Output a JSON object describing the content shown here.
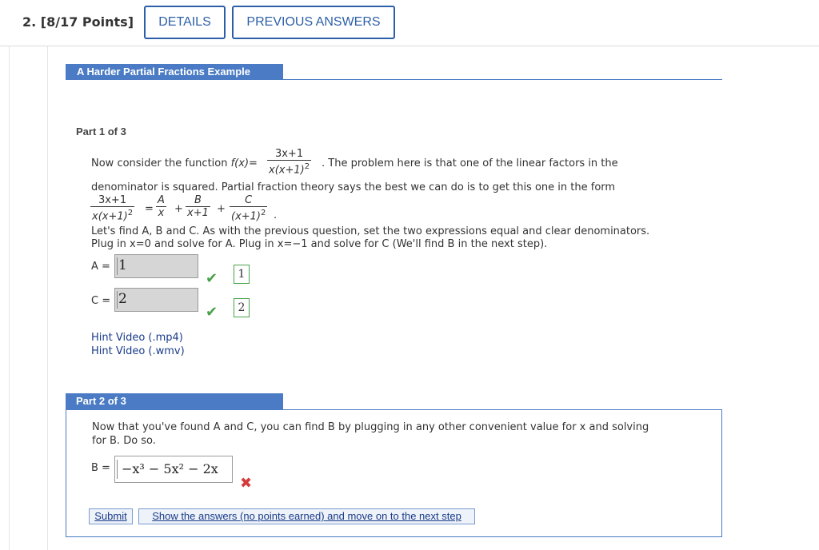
{
  "header": {
    "question_number": "2.",
    "points": "[8/17 Points]",
    "details_label": "DETAILS",
    "previous_answers_label": "PREVIOUS ANSWERS"
  },
  "section": {
    "title": "A Harder Partial Fractions Example"
  },
  "part1": {
    "label": "Part 1 of 3",
    "intro_prefix": "Now consider the function ",
    "fx": "f(x)=",
    "f_num": "3x+1",
    "f_den": "x(x+1)",
    "intro_suffix": ". The problem here is that one of the linear factors in the",
    "line2": "denominator is squared. Partial fraction theory says the best we can do is to get this one in the form",
    "eq_lhs_num": "3x+1",
    "eq_lhs_den": "x(x+1)",
    "eq_a_num": "A",
    "eq_a_den": "x",
    "eq_b_num": "B",
    "eq_b_den": "x+1",
    "eq_c_num": "C",
    "eq_c_den": "(x+1)",
    "line3": "Let's find A, B and C. As with the previous question, set the two expressions equal and clear denominators.",
    "line4": "Plug in x=0 and solve for A. Plug in x=−1 and solve for C (We'll find B in the next step).",
    "a_label": "A =",
    "a_value": "1",
    "a_key": "1",
    "c_label": "C =",
    "c_value": "2",
    "c_key": "2",
    "hint_mp4": "Hint Video (.mp4)",
    "hint_wmv": "Hint Video (.wmv)"
  },
  "part2": {
    "label": "Part 2 of 3",
    "line1": "Now that you've found A and C, you can find B by plugging in any other convenient value for x and solving",
    "line2": "for B. Do so.",
    "b_label": "B =",
    "b_value": "−x³ − 5x² − 2x",
    "submit_label": "Submit",
    "show_answers_label": "Show the answers (no points earned) and move on to the next step"
  },
  "colors": {
    "accent": "#4a7bc4",
    "correct": "#4aa24a",
    "incorrect": "#d43b3b"
  }
}
